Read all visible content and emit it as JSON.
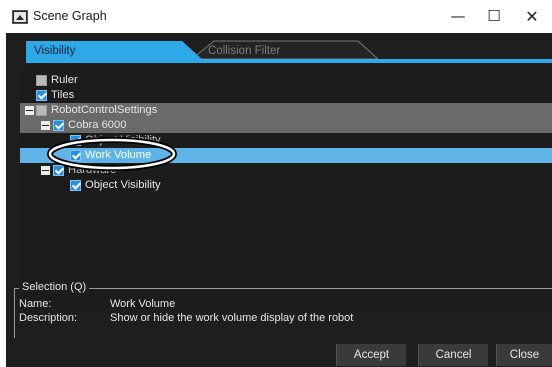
{
  "window": {
    "title": "Scene Graph",
    "minimize_glyph": "—",
    "maximize_glyph": "☐",
    "close_glyph": "✕"
  },
  "tabs": [
    {
      "label": "Visibility",
      "active": true
    },
    {
      "label": "Collision Filter",
      "active": false
    }
  ],
  "tree": {
    "items": [
      {
        "label": "Ruler",
        "checked": false
      },
      {
        "label": "Tiles",
        "checked": true
      },
      {
        "label": "RobotControlSettings",
        "checked": false
      },
      {
        "label": "Cobra 6000",
        "checked": true
      },
      {
        "label": "Object Visibility",
        "checked": true
      },
      {
        "label": "Work Volume",
        "checked": true,
        "selected": true
      },
      {
        "label": "Hardware",
        "checked": true
      },
      {
        "label": "Object Visibility",
        "checked": true
      }
    ]
  },
  "selection": {
    "title": "Selection (Q)",
    "name_label": "Name:",
    "name_value": "Work Volume",
    "description_label": "Description:",
    "description_value": "Show or hide the work volume display of the robot"
  },
  "buttons": {
    "accept": "Accept",
    "cancel": "Cancel",
    "close": "Close"
  },
  "colors": {
    "accent": "#2ea8e6",
    "selection": "#5fb3e6",
    "background": "#1e1e1e"
  }
}
